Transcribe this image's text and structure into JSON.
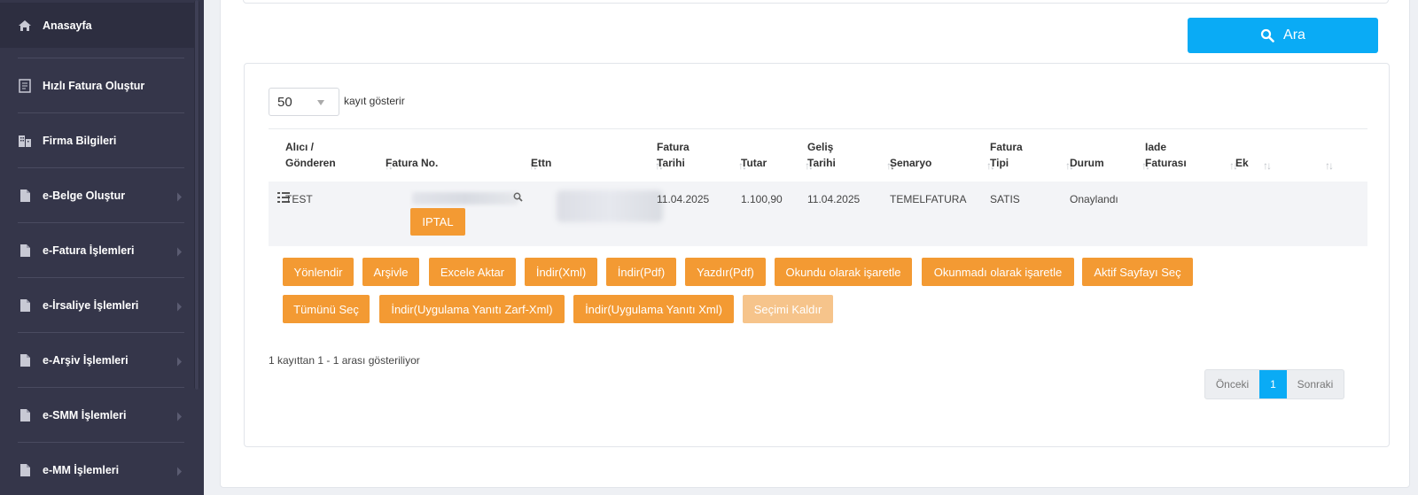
{
  "sidebar": {
    "items": [
      {
        "label": "Anasayfa",
        "icon": "home-icon"
      },
      {
        "label": "Hızlı Fatura Oluştur",
        "icon": "document-icon"
      },
      {
        "label": "Firma Bilgileri",
        "icon": "building-icon"
      },
      {
        "label": "e-Belge Oluştur",
        "icon": "file-icon"
      },
      {
        "label": "e-Fatura İşlemleri",
        "icon": "file-icon"
      },
      {
        "label": "e-İrsaliye İşlemleri",
        "icon": "file-icon"
      },
      {
        "label": "e-Arşiv İşlemleri",
        "icon": "file-icon"
      },
      {
        "label": "e-SMM İşlemleri",
        "icon": "file-icon"
      },
      {
        "label": "e-MM İşlemleri",
        "icon": "file-icon"
      }
    ]
  },
  "search": {
    "label": "Ara"
  },
  "table": {
    "page_length": "50",
    "page_length_label": "kayıt gösterir",
    "columns": [
      "Alıcı /\nGönderen",
      "Fatura No.",
      "Ettn",
      "Fatura\nTarihi",
      "Tutar",
      "Geliş\nTarihi",
      "Senaryo",
      "Fatura\nTipi",
      "Durum",
      "Iade\nFaturası",
      "Ek"
    ],
    "row": {
      "alici": "TEST",
      "fatura_tarihi": "11.04.2025",
      "tutar": "1.100,90",
      "gelis_tarihi": "11.04.2025",
      "senaryo": "TEMELFATURA",
      "fatura_tipi": "SATIS",
      "durum": "Onaylandı",
      "iptal_label": "IPTAL"
    },
    "info": "1 kayıttan 1 - 1 arası gösteriliyor"
  },
  "actions": {
    "row1": [
      "Yönlendir",
      "Arşivle",
      "Excele Aktar",
      "İndir(Xml)",
      "İndir(Pdf)",
      "Yazdır(Pdf)",
      "Okundu olarak işaretle",
      "Okunmadı olarak işaretle",
      "Aktif Sayfayı Seç"
    ],
    "row2": [
      "Tümünü Seç",
      "İndir(Uygulama Yanıtı Zarf-Xml)",
      "İndir(Uygulama Yanıtı Xml)",
      "Seçimi Kaldır"
    ]
  },
  "pagination": {
    "prev": "Önceki",
    "current": "1",
    "next": "Sonraki"
  },
  "colors": {
    "sidebar": "#35364a",
    "accent_blue": "#0aabf5",
    "action_orange": "#f39a33"
  }
}
